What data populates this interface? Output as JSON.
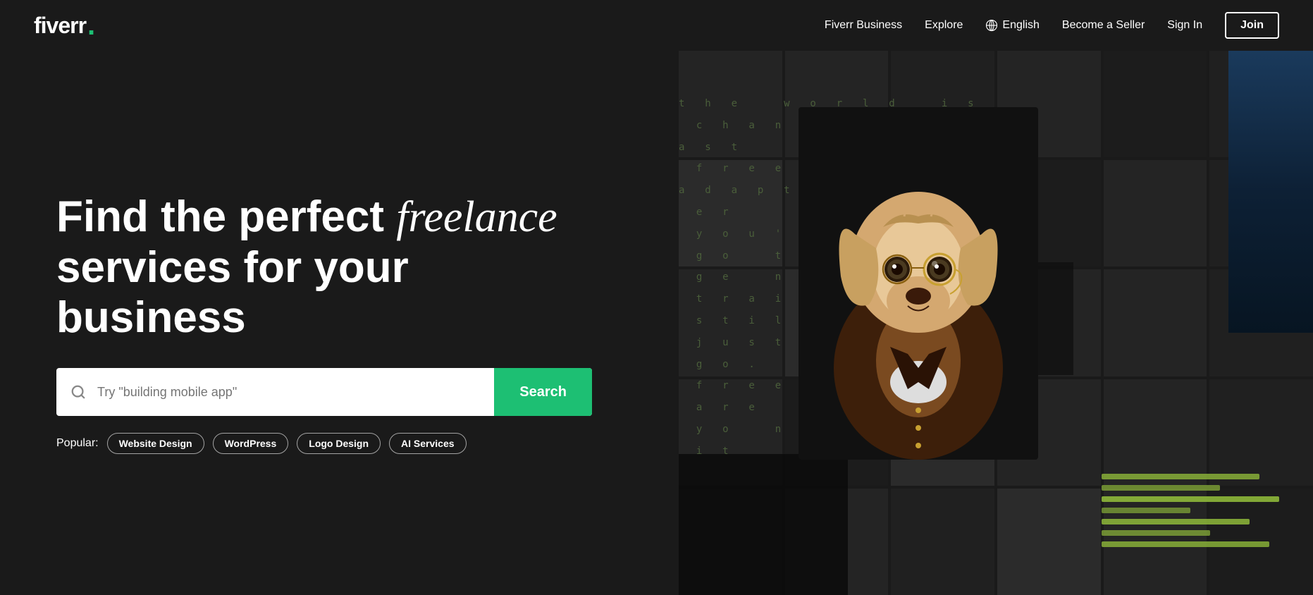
{
  "logo": {
    "text": "fiverr",
    "dot": "."
  },
  "navbar": {
    "business_label": "Fiverr Business",
    "explore_label": "Explore",
    "language_label": "English",
    "become_seller_label": "Become a Seller",
    "signin_label": "Sign In",
    "join_label": "Join"
  },
  "hero": {
    "title_line1": "Find the perfect ",
    "title_italic": "freelance",
    "title_line2": "services for your business",
    "search_placeholder": "Try \"building mobile app\"",
    "search_btn": "Search",
    "popular_label": "Popular:",
    "popular_tags": [
      "Website Design",
      "WordPress",
      "Logo Design",
      "AI Services"
    ]
  },
  "decorative_text": "t  h  e     w  o  r  l  d     i  s\n  c  h  a  n  g  i  n  g  .     f\na  s  t\n  f  r  e  e\na  d  a  p  t\n  e  r\n  y  o  u  '  v\n  g  o     t  t\n  g  e     n  e\n  t  r  a  i  n\n  s  t  i  l  l\n  j  u  s  t\n  g  o  .\n  f  r  e  e\n  a  r  e\n  y  o     n\n  i  t",
  "colors": {
    "background": "#1a1a1a",
    "accent_green": "#1dbf73",
    "text_white": "#ffffff",
    "decorative_green": "#4a5e3a"
  },
  "code_lines": [
    {
      "width": "80%",
      "opacity": 0.9
    },
    {
      "width": "60%",
      "opacity": 0.8
    },
    {
      "width": "90%",
      "opacity": 0.85
    },
    {
      "width": "45%",
      "opacity": 0.7
    },
    {
      "width": "70%",
      "opacity": 0.9
    },
    {
      "width": "55%",
      "opacity": 0.75
    },
    {
      "width": "85%",
      "opacity": 0.8
    }
  ]
}
